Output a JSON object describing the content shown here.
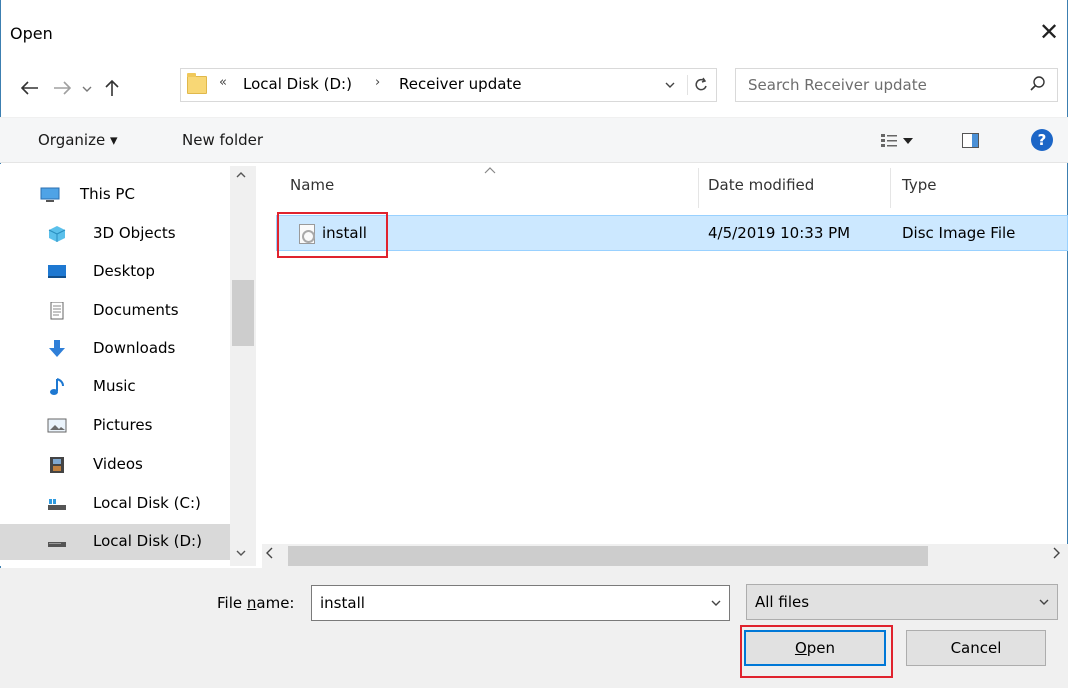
{
  "window": {
    "title": "Open",
    "close_symbol": "✕"
  },
  "nav": {
    "back_icon": "arrow-left-icon",
    "forward_icon": "arrow-right-icon",
    "recent_icon": "chevron-down-icon",
    "up_icon": "arrow-up-icon"
  },
  "address": {
    "overflow": "«",
    "crumbs": [
      "Local Disk (D:)",
      "Receiver update"
    ],
    "separator": "›"
  },
  "search": {
    "placeholder": "Search Receiver update"
  },
  "toolbar": {
    "organize": "Organize ▾",
    "new_folder": "New folder",
    "help": "?"
  },
  "sidebar": {
    "items": [
      {
        "label": "This PC",
        "icon": "computer-icon"
      },
      {
        "label": "3D Objects",
        "icon": "cube-icon"
      },
      {
        "label": "Desktop",
        "icon": "desktop-icon"
      },
      {
        "label": "Documents",
        "icon": "document-icon"
      },
      {
        "label": "Downloads",
        "icon": "download-icon"
      },
      {
        "label": "Music",
        "icon": "music-icon"
      },
      {
        "label": "Pictures",
        "icon": "picture-icon"
      },
      {
        "label": "Videos",
        "icon": "video-icon"
      },
      {
        "label": "Local Disk (C:)",
        "icon": "drive-icon"
      },
      {
        "label": "Local Disk (D:)",
        "icon": "drive-icon",
        "selected": true
      }
    ]
  },
  "files": {
    "columns": [
      "Name",
      "Date modified",
      "Type"
    ],
    "rows": [
      {
        "name": "install",
        "date": "4/5/2019 10:33 PM",
        "type": "Disc Image File",
        "selected": true
      }
    ]
  },
  "bottom": {
    "file_name_prefix": "File ",
    "file_name_underlined": "n",
    "file_name_suffix": "ame:",
    "file_name_value": "install",
    "file_type_value": "All files",
    "open_underlined": "O",
    "open_rest": "pen",
    "cancel": "Cancel"
  },
  "colors": {
    "accent": "#0078d7",
    "selection": "#cce8ff",
    "highlight_box": "#e0232e"
  }
}
